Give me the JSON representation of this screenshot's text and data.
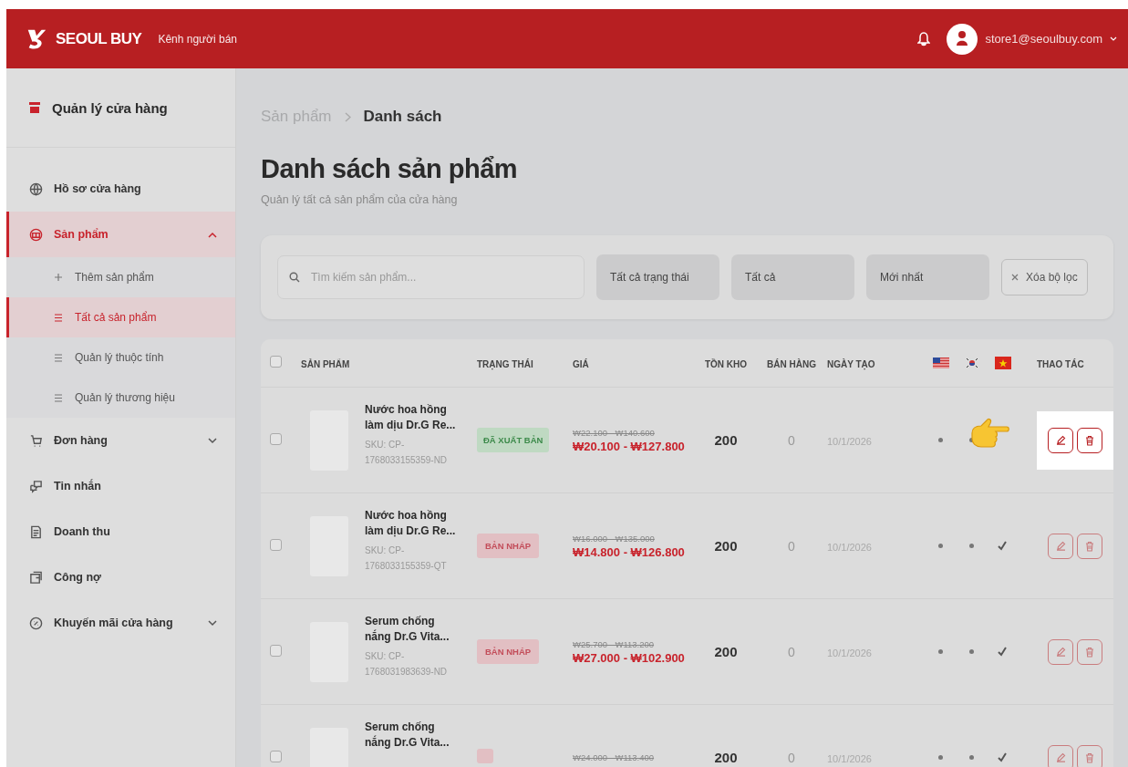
{
  "header": {
    "brand": "SEOUL BUY",
    "subtitle": "Kênh người bán",
    "user_email": "store1@seoulbuy.com"
  },
  "sidebar": {
    "title": "Quản lý cửa hàng",
    "items": [
      {
        "label": "Hồ sơ cửa hàng",
        "selected": false
      },
      {
        "label": "Sản phẩm",
        "selected": true,
        "expanded": true,
        "children": [
          {
            "label": "Thêm sản phẩm",
            "selected": false
          },
          {
            "label": "Tất cả sản phẩm",
            "selected": true
          },
          {
            "label": "Quản lý thuộc tính",
            "selected": false
          },
          {
            "label": "Quản lý thương hiệu",
            "selected": false
          }
        ]
      },
      {
        "label": "Đơn hàng",
        "selected": false,
        "expanded": false
      },
      {
        "label": "Tin nhắn",
        "selected": false
      },
      {
        "label": "Doanh thu",
        "selected": false
      },
      {
        "label": "Công nợ",
        "selected": false
      },
      {
        "label": "Khuyến mãi cửa hàng",
        "selected": false,
        "expanded": false
      }
    ]
  },
  "breadcrumb": [
    "Sản phẩm",
    "Danh sách"
  ],
  "page_title": "Danh sách sản phẩm",
  "page_subtitle": "Quản lý tất cả sản phẩm của cửa hàng",
  "filters": {
    "search": {
      "placeholder": "Tìm kiếm sản phẩm..."
    },
    "selects": [
      "Tất cả trạng thái",
      "Tất cả",
      "Mới nhất"
    ],
    "clear_button": "Xóa bộ lọc"
  },
  "table": {
    "header_checked": false,
    "columns": [
      "SẢN PHẨM",
      "TRẠNG THÁI",
      "GIÁ",
      "TỒN KHO",
      "BÁN HÀNG",
      "NGÀY TẠO"
    ],
    "actions_column": "THAO TÁC",
    "rows": [
      {
        "checked": false,
        "name": "Nước hoa hồng làm dịu Dr.G Re...",
        "sku": "SKU: CP-1768033155359-ND",
        "status": {
          "kind": "published",
          "label": "ĐÃ XUẤT BẢN"
        },
        "price_original": "₩22.100 - ₩140.600",
        "price": "₩20.100 - ₩127.800",
        "stock": "200",
        "sold": "0",
        "created": "10/1/2026",
        "translations": [
          {
            "done": false
          },
          {
            "done": false
          }
        ],
        "highlighted": true
      },
      {
        "checked": false,
        "name": "Nước hoa hồng làm dịu Dr.G Re...",
        "sku": "SKU: CP-1768033155359-QT",
        "status": {
          "kind": "draft",
          "label": "BẢN NHÁP"
        },
        "price_original": "₩16.000 - ₩135.000",
        "price": "₩14.800 - ₩126.800",
        "stock": "200",
        "sold": "0",
        "created": "10/1/2026",
        "translations": [
          {
            "done": false
          },
          {
            "done": false
          },
          {
            "done": true
          }
        ],
        "highlighted": false
      },
      {
        "checked": false,
        "name": "Serum chống nắng Dr.G Vita...",
        "sku": "SKU: CP-1768031983639-ND",
        "status": {
          "kind": "draft",
          "label": "BẢN NHÁP"
        },
        "price_original": "₩25.700 - ₩113.200",
        "price": "₩27.000 - ₩102.900",
        "stock": "200",
        "sold": "0",
        "created": "10/1/2026",
        "translations": [
          {
            "done": false
          },
          {
            "done": false
          },
          {
            "done": true
          }
        ],
        "highlighted": false
      },
      {
        "checked": false,
        "name": "Serum chống nắng Dr.G Vita...",
        "status": {
          "kind": "draft"
        },
        "price_original": "₩24.000 - ₩113.400",
        "stock": "200",
        "sold": "0",
        "created": "10/1/2026",
        "translations": [
          {
            "done": false
          },
          {
            "done": false
          },
          {
            "done": true
          }
        ],
        "highlighted": false
      }
    ]
  }
}
